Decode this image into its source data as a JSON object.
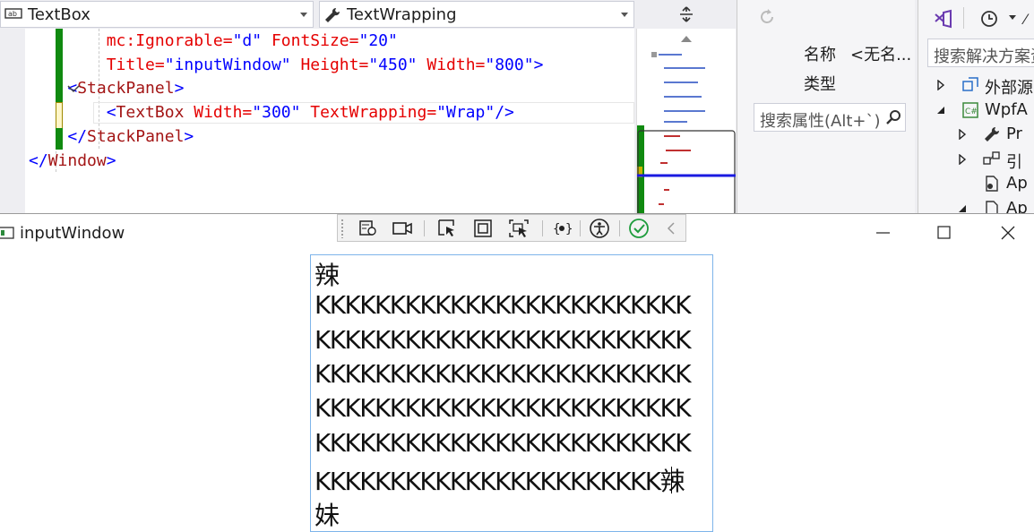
{
  "ide": {
    "element_combo": "TextBox",
    "property_combo": "TextWrapping",
    "code_lines": [
      {
        "indent": "        ",
        "parts": [
          {
            "t": "mc:Ignorable=",
            "c": "attr"
          },
          {
            "t": "\"d\"",
            "c": "val"
          },
          {
            "t": " FontSize=",
            "c": "attr"
          },
          {
            "t": "\"20\"",
            "c": "val"
          }
        ]
      },
      {
        "indent": "        ",
        "parts": [
          {
            "t": "Title=",
            "c": "attr"
          },
          {
            "t": "\"inputWindow\"",
            "c": "val"
          },
          {
            "t": " Height=",
            "c": "attr"
          },
          {
            "t": "\"450\"",
            "c": "val"
          },
          {
            "t": " Width=",
            "c": "attr"
          },
          {
            "t": "\"800\"",
            "c": "val"
          },
          {
            "t": ">",
            "c": "br"
          }
        ]
      },
      {
        "indent": "    ",
        "parts": [
          {
            "t": "<",
            "c": "br"
          },
          {
            "t": "StackPanel",
            "c": "tag"
          },
          {
            "t": ">",
            "c": "br"
          }
        ]
      },
      {
        "indent": "        ",
        "parts": [
          {
            "t": "<",
            "c": "br"
          },
          {
            "t": "TextBox",
            "c": "tag"
          },
          {
            "t": " Width=",
            "c": "attr"
          },
          {
            "t": "\"300\"",
            "c": "val"
          },
          {
            "t": " TextWrapping=",
            "c": "attr"
          },
          {
            "t": "\"Wrap\"",
            "c": "val"
          },
          {
            "t": "/>",
            "c": "br"
          }
        ]
      },
      {
        "indent": "    ",
        "parts": [
          {
            "t": "</",
            "c": "br"
          },
          {
            "t": "StackPanel",
            "c": "tag"
          },
          {
            "t": ">",
            "c": "br"
          }
        ]
      },
      {
        "indent": "",
        "parts": [
          {
            "t": "</",
            "c": "br"
          },
          {
            "t": "Window",
            "c": "tag"
          },
          {
            "t": ">",
            "c": "br"
          }
        ]
      }
    ],
    "properties": {
      "name_label": "名称",
      "name_value": "<无名...",
      "type_label": "类型",
      "search_placeholder": "搜索属性(Alt+`)"
    },
    "solution": {
      "search_placeholder": "搜索解决方案资",
      "tree": [
        {
          "label": "外部源",
          "icon": "external-sources-icon",
          "expander": "collapsed"
        },
        {
          "label": "WpfA",
          "icon": "csharp-project-icon",
          "expander": "expanded"
        },
        {
          "label": "Pr",
          "icon": "wrench-icon",
          "expander": "collapsed"
        },
        {
          "label": "引",
          "icon": "references-icon",
          "expander": "collapsed"
        },
        {
          "label": "Ap",
          "icon": "app-config-icon",
          "expander": "none"
        },
        {
          "label": "Ap",
          "icon": "file-icon",
          "expander": "expanded"
        }
      ]
    }
  },
  "window": {
    "title": "inputWindow",
    "textbox_lines": [
      "辣",
      "KKKKKKKKKKKKKKKKKKKKKKKKK",
      "KKKKKKKKKKKKKKKKKKKKKKKKK",
      "KKKKKKKKKKKKKKKKKKKKKKKKK",
      "KKKKKKKKKKKKKKKKKKKKKKKKK",
      "KKKKKKKKKKKKKKKKKKKKKKKKK",
      "KKKKKKKKKKKKKKKKKKKKKKK辣",
      "妹"
    ]
  }
}
